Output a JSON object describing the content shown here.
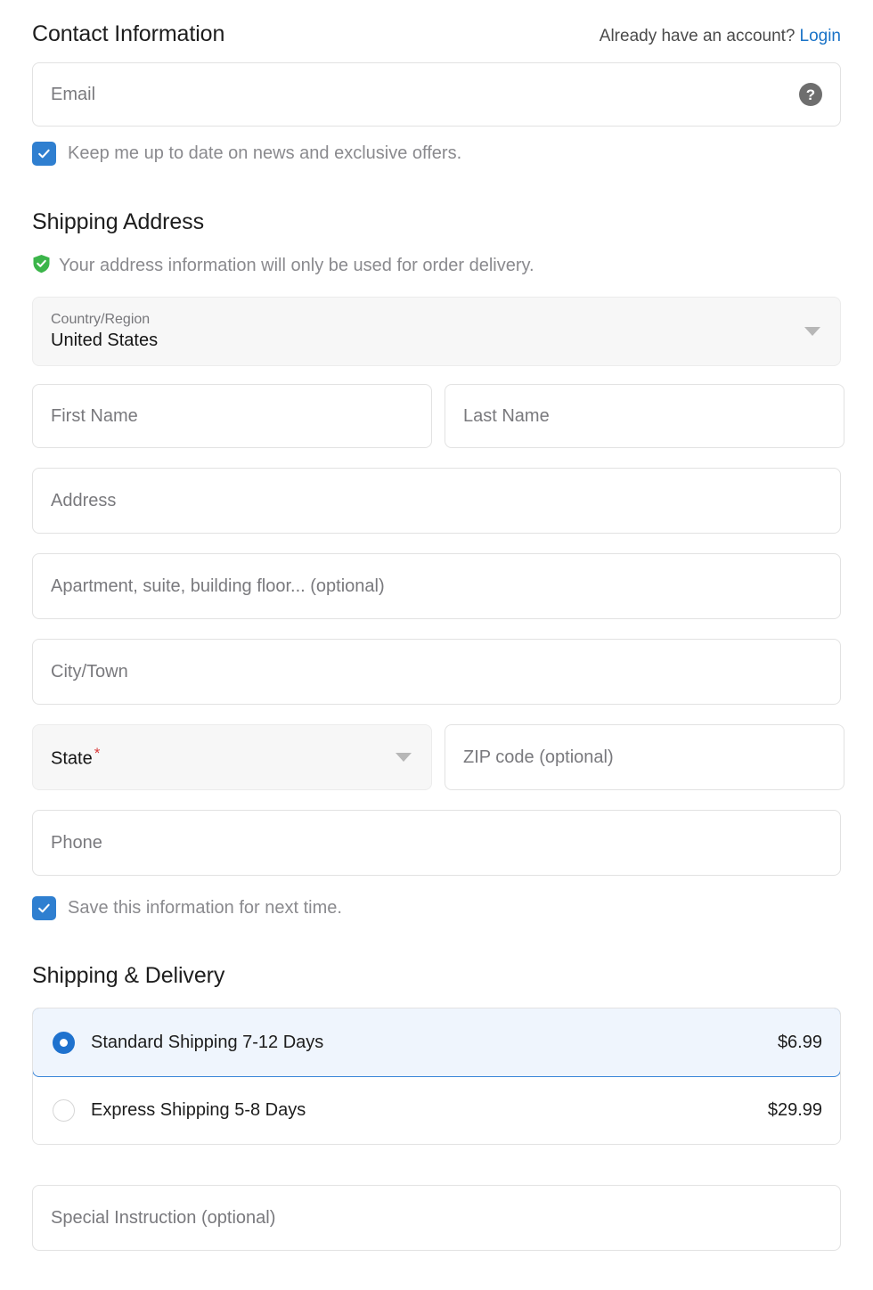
{
  "contact": {
    "title": "Contact Information",
    "account_prompt": "Already have an account?",
    "login_label": "Login",
    "email_placeholder": "Email",
    "help_icon_glyph": "?",
    "newsletter_checkbox": {
      "label": "Keep me up to date on news and exclusive offers.",
      "checked": true
    }
  },
  "shipping_address": {
    "title": "Shipping Address",
    "privacy_note": "Your address information will only be used for order delivery.",
    "country": {
      "label": "Country/Region",
      "value": "United States"
    },
    "first_name_placeholder": "First Name",
    "last_name_placeholder": "Last Name",
    "address_placeholder": "Address",
    "apartment_placeholder": "Apartment, suite, building floor... (optional)",
    "city_placeholder": "City/Town",
    "state": {
      "label": "State",
      "required_marker": "*"
    },
    "zip_placeholder": "ZIP code (optional)",
    "phone_placeholder": "Phone",
    "save_checkbox": {
      "label": "Save this information for next time.",
      "checked": true
    }
  },
  "shipping_delivery": {
    "title": "Shipping & Delivery",
    "options": [
      {
        "label": "Standard Shipping 7-12 Days",
        "price": "$6.99",
        "selected": true
      },
      {
        "label": "Express Shipping 5-8 Days",
        "price": "$29.99",
        "selected": false
      }
    ]
  },
  "special_instruction": {
    "placeholder": "Special Instruction (optional)"
  },
  "colors": {
    "accent_blue": "#2f7fd0",
    "link_blue": "#1a73c7",
    "selected_bg": "#eff5fd",
    "selected_border": "#3a86d8",
    "shield_green": "#3bb54a",
    "required_red": "#d93a3a",
    "placeholder_gray": "#79797d",
    "muted_gray": "#8a8a8e"
  }
}
